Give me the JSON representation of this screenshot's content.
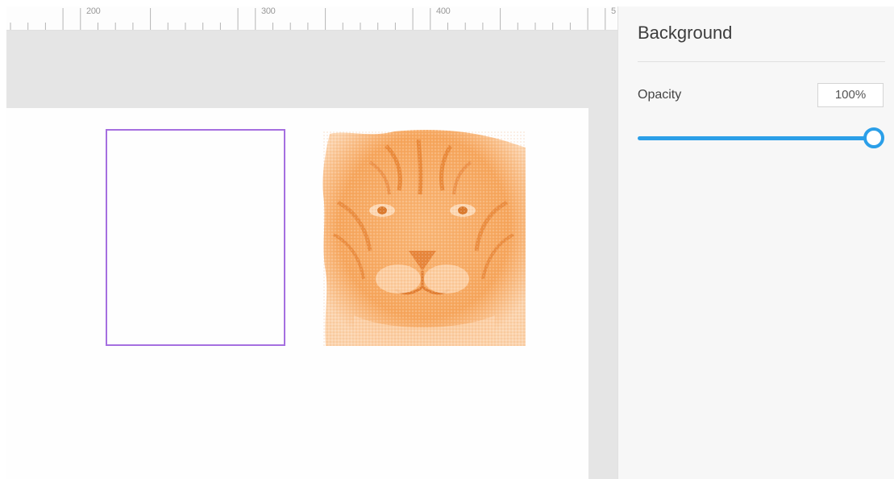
{
  "ruler": {
    "labels": [
      "200",
      "300",
      "400",
      "5"
    ]
  },
  "panel": {
    "title": "Background",
    "opacity": {
      "label": "Opacity",
      "value": "100%",
      "fraction": 1.0
    }
  },
  "colors": {
    "accent": "#2b9fe8",
    "selection": "#a56fe0",
    "image_tint": "#f7a15a",
    "canvas_bg": "#e5e5e5",
    "panel_bg": "#f7f7f7"
  },
  "icons": {
    "opacity_slider_thumb": "slider-thumb-icon"
  }
}
